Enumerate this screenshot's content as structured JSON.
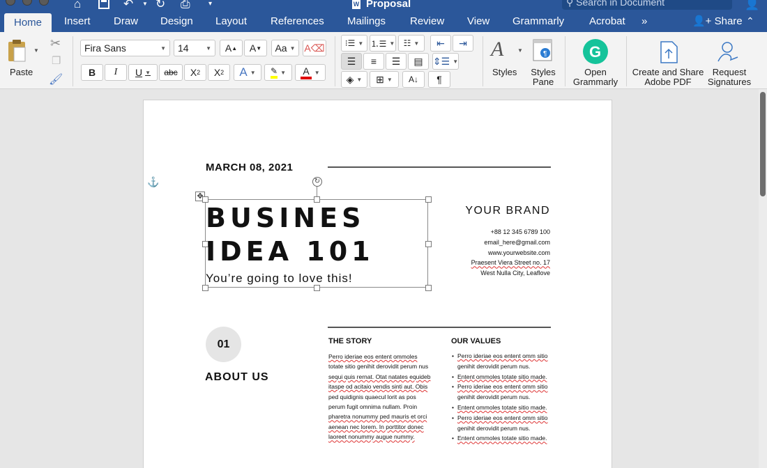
{
  "window": {
    "title": "Proposal",
    "search_placeholder": "Search in Document"
  },
  "tabs": [
    "Home",
    "Insert",
    "Draw",
    "Design",
    "Layout",
    "References",
    "Mailings",
    "Review",
    "View",
    "Grammarly",
    "Acrobat"
  ],
  "share_label": "Share",
  "ribbon": {
    "paste_label": "Paste",
    "font_name": "Fira Sans",
    "font_size": "14",
    "styles_label": "Styles",
    "styles_pane_label": [
      "Styles",
      "Pane"
    ],
    "open_grammarly_label": [
      "Open",
      "Grammarly"
    ],
    "create_share_label": [
      "Create and Share",
      "Adobe PDF"
    ],
    "request_signatures_label": [
      "Request",
      "Signatures"
    ]
  },
  "colors": {
    "accent": "#2b579a",
    "highlight": "#ffff00",
    "font_color": "#e00000",
    "grammarly": "#15c39a"
  },
  "document": {
    "date": "MARCH 08, 2021",
    "title_line1": "BUSINES",
    "title_line2": "IDEA 101",
    "tagline": "You’re going to love this!",
    "brand": "YOUR BRAND",
    "contact": {
      "phone": "+88 12 345 6789 100",
      "email": "email_here@gmail.com",
      "website": "www.yourwebsite.com",
      "street": "Praesent Viera Street no. 17",
      "city": "West Nulla City, Leaflove"
    },
    "section_number": "01",
    "section_title": "ABOUT US",
    "story_heading": "THE STORY",
    "story_lines": [
      "Perro ideriae eos entent ommoles",
      "totate sitio genihit derovidit perum nus",
      "sequi quis rernat. Otat natates equideb",
      "itaspe od acitaio vendis sinti aut. Obis",
      "ped quidignis quaecul lorit as pos",
      "perum fugit omnima nullam. Proin",
      "pharetra nonummy ped mauris et orci",
      "aenean nec lorem. In porttitor donec",
      "laoreet nonummy augue nummy."
    ],
    "values_heading": "OUR VALUES",
    "values_items": [
      [
        "Perro ideriae eos entent omm sitio",
        "genihit derovidit perum nus."
      ],
      [
        "Entent ommoles totate sitio made."
      ],
      [
        "Perro ideriae eos entent omm sitio",
        "genihit derovidit perum nus."
      ],
      [
        "Entent ommoles totate sitio made."
      ],
      [
        "Perro ideriae eos entent omm sitio",
        "genihit derovidit perum nus."
      ],
      [
        "Entent ommoles totate sitio made."
      ]
    ]
  }
}
